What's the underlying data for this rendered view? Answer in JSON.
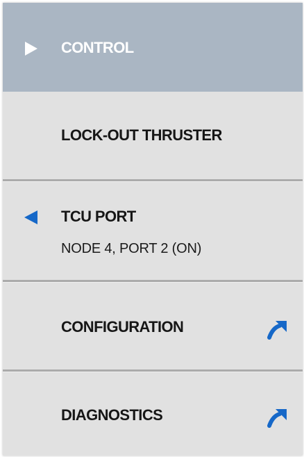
{
  "menu": {
    "items": [
      {
        "label": "CONTROL",
        "icon": "play-arrow-icon",
        "selected": true
      },
      {
        "label": "LOCK-OUT THRUSTER"
      },
      {
        "label": "TCU PORT",
        "value": "NODE 4, PORT 2 (ON)",
        "icon": "back-arrow-icon"
      },
      {
        "label": "CONFIGURATION",
        "icon": "external-link-icon"
      },
      {
        "label": "DIAGNOSTICS",
        "icon": "external-link-icon"
      }
    ]
  },
  "colors": {
    "selected_background": "#aab6c3",
    "menu_background": "#e1e1e1",
    "accent_blue": "#1668c8"
  }
}
